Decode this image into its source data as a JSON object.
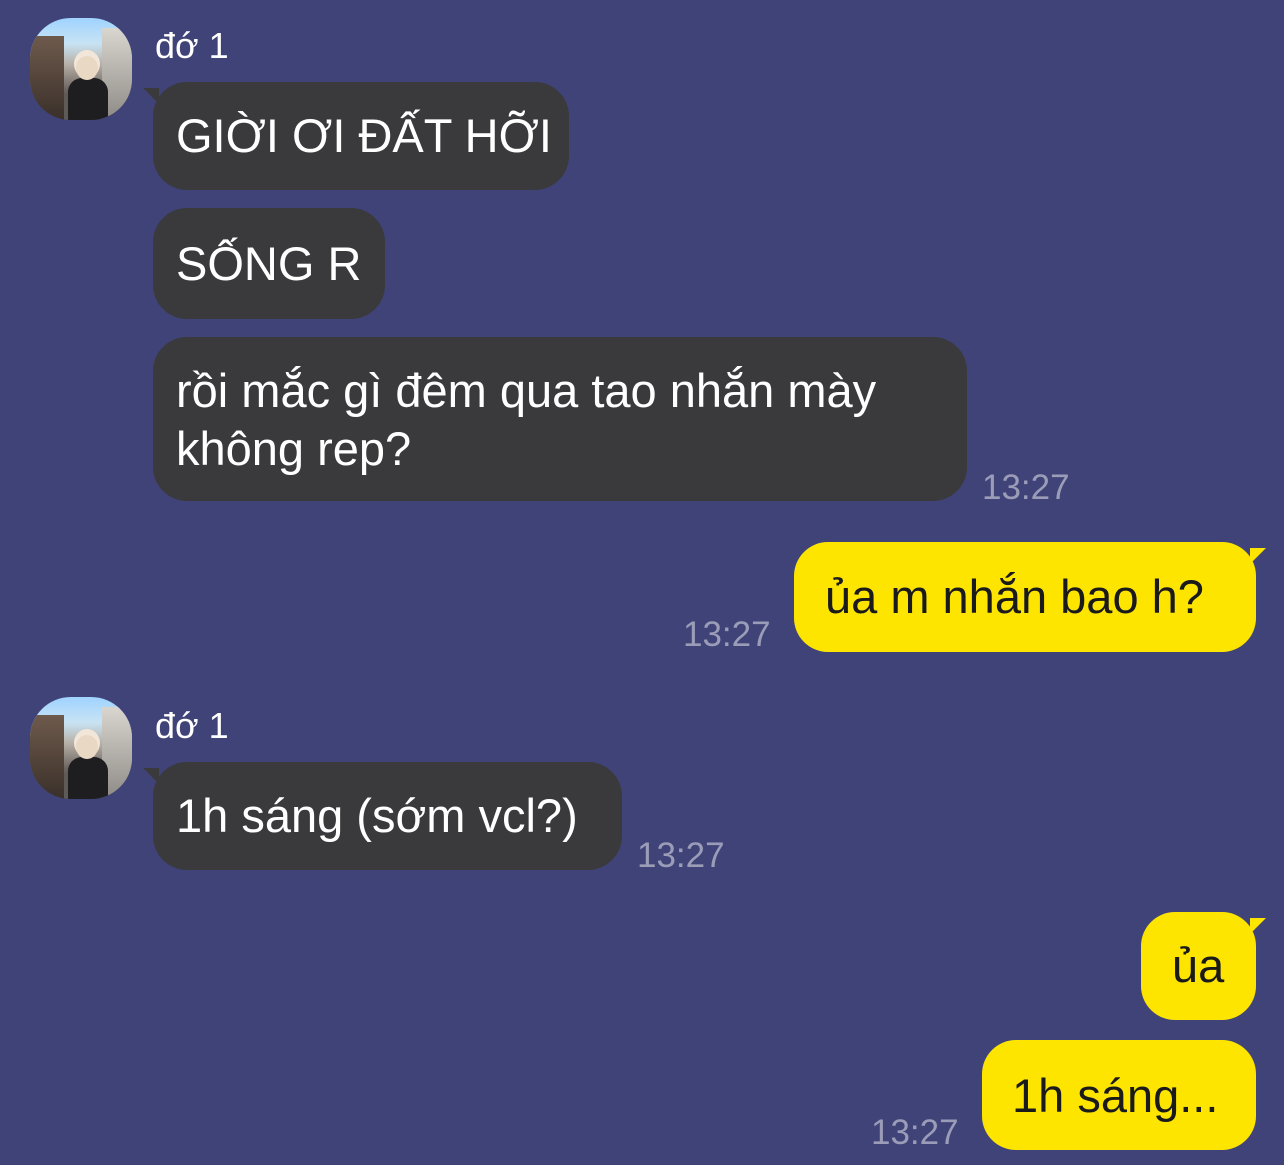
{
  "chat": {
    "contact_name": "đớ 1",
    "messages": [
      {
        "side": "in",
        "text": "GIỜI ƠI ĐẤT HỠI"
      },
      {
        "side": "in",
        "text": "SỐNG R"
      },
      {
        "side": "in",
        "text_line1": "rồi mắc gì đêm qua tao nhắn mày",
        "text_line2": "không rep?",
        "time": "13:27"
      },
      {
        "side": "out",
        "text": "ủa m nhắn bao h?",
        "time": "13:27"
      },
      {
        "side": "in",
        "text": "1h sáng (sớm vcl?)",
        "time": "13:27"
      },
      {
        "side": "out",
        "text": "ủa"
      },
      {
        "side": "out",
        "text": "1h sáng...",
        "time": "13:27"
      }
    ]
  },
  "colors": {
    "background": "#3f4378",
    "incoming_bubble": "#3a3a3c",
    "outgoing_bubble": "#fee500",
    "timestamp": "#9b9db8"
  }
}
